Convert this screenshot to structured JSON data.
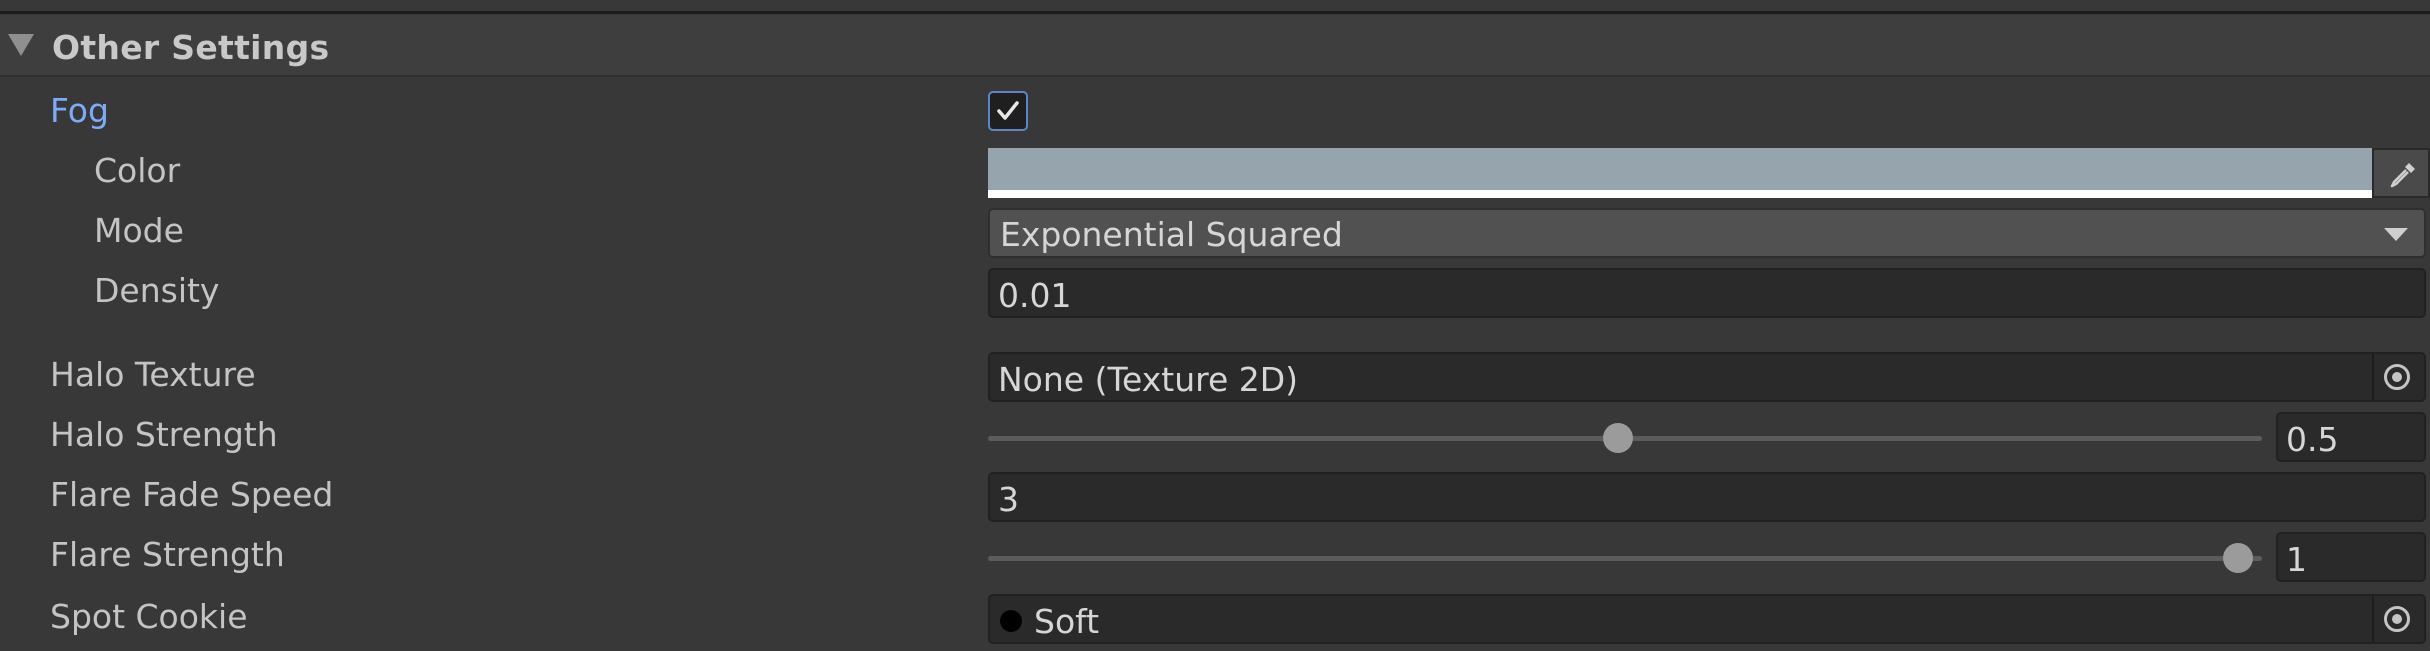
{
  "section": {
    "title": "Other Settings"
  },
  "fog": {
    "label": "Fog",
    "checked": true
  },
  "color": {
    "label": "Color",
    "value": "#96a4ad"
  },
  "mode": {
    "label": "Mode",
    "value": "Exponential Squared"
  },
  "density": {
    "label": "Density",
    "value": "0.01"
  },
  "halo_texture": {
    "label": "Halo Texture",
    "value": "None (Texture 2D)"
  },
  "halo_strength": {
    "label": "Halo Strength",
    "value": "0.5",
    "fraction": 0.5
  },
  "flare_fade_speed": {
    "label": "Flare Fade Speed",
    "value": "3"
  },
  "flare_strength": {
    "label": "Flare Strength",
    "value": "1",
    "fraction": 1.0
  },
  "spot_cookie": {
    "label": "Spot Cookie",
    "value": "Soft"
  },
  "icons": {
    "section_toggle": "triangle-down-icon",
    "fog_check": "checkmark-icon",
    "eyedropper": "eyedropper-icon",
    "dropdown": "chevron-down-icon",
    "object_picker": "object-picker-icon"
  },
  "colors": {
    "accent_label": "#7cacf8",
    "panel_bg": "#383838"
  }
}
